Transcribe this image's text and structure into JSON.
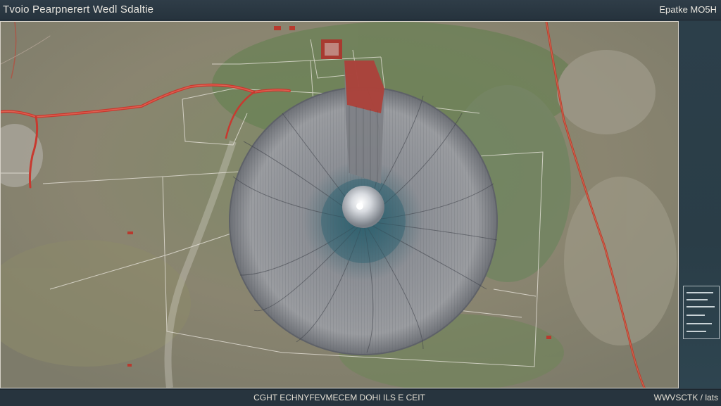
{
  "header": {
    "title": "Tvoio Pearpnerert Wedl Sdaltie",
    "mode": "Epatke MO5H"
  },
  "footer": {
    "caption": "CGHT ECHNYFEVMECEM DOHI ILS E CEIT",
    "scale": "WWVSCTK / lats"
  },
  "map": {
    "feature": "circular-spiral-pit",
    "colors": {
      "terrain": "#8a8a6e",
      "vegetation": "#6f8a5a",
      "roads": "#c8392f",
      "pit": "#8d9096",
      "pit_center": "#2f6f80",
      "parcels": "#e8e4dc"
    }
  },
  "legend": {
    "icon": "legend-lines-icon"
  }
}
